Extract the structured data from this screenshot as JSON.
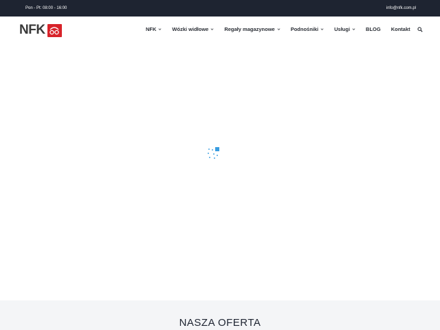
{
  "topbar": {
    "hours": "Pon - Pt: 08:00 - 16:00",
    "email": "info@nfk.com.pl"
  },
  "logo": {
    "text": "NFK",
    "mark_icon": "forklift-icon",
    "mark_color": "#d8232a"
  },
  "menu": {
    "items": [
      {
        "label": "NFK",
        "has_dropdown": true
      },
      {
        "label": "Wózki widłowe",
        "has_dropdown": true
      },
      {
        "label": "Regały magazynowe",
        "has_dropdown": true
      },
      {
        "label": "Podnośniki",
        "has_dropdown": true
      },
      {
        "label": "Usługi",
        "has_dropdown": true
      },
      {
        "label": "BLOG",
        "has_dropdown": false
      },
      {
        "label": "Kontakt",
        "has_dropdown": false
      }
    ],
    "search_icon": "search-icon"
  },
  "offer": {
    "title": "NASZA OFERTA"
  },
  "colors": {
    "topbar_bg": "#1e2431",
    "accent": "#d8232a",
    "loader": "#3a9de0",
    "section_bg": "#f4f5f7"
  }
}
